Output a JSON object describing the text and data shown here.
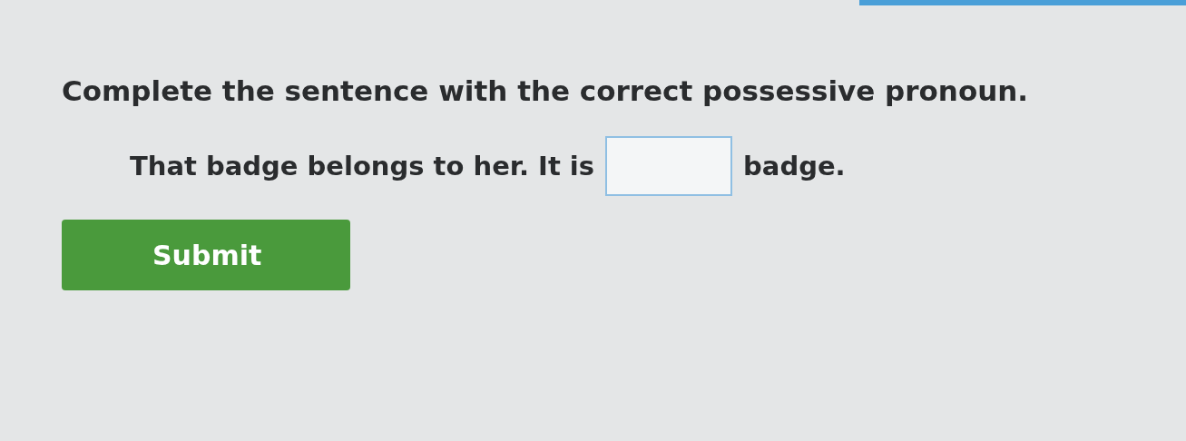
{
  "instruction": "Complete the sentence with the correct possessive pronoun.",
  "sentence": {
    "before": "That badge belongs to her. It is",
    "after": "badge."
  },
  "submit": {
    "label": "Submit"
  }
}
